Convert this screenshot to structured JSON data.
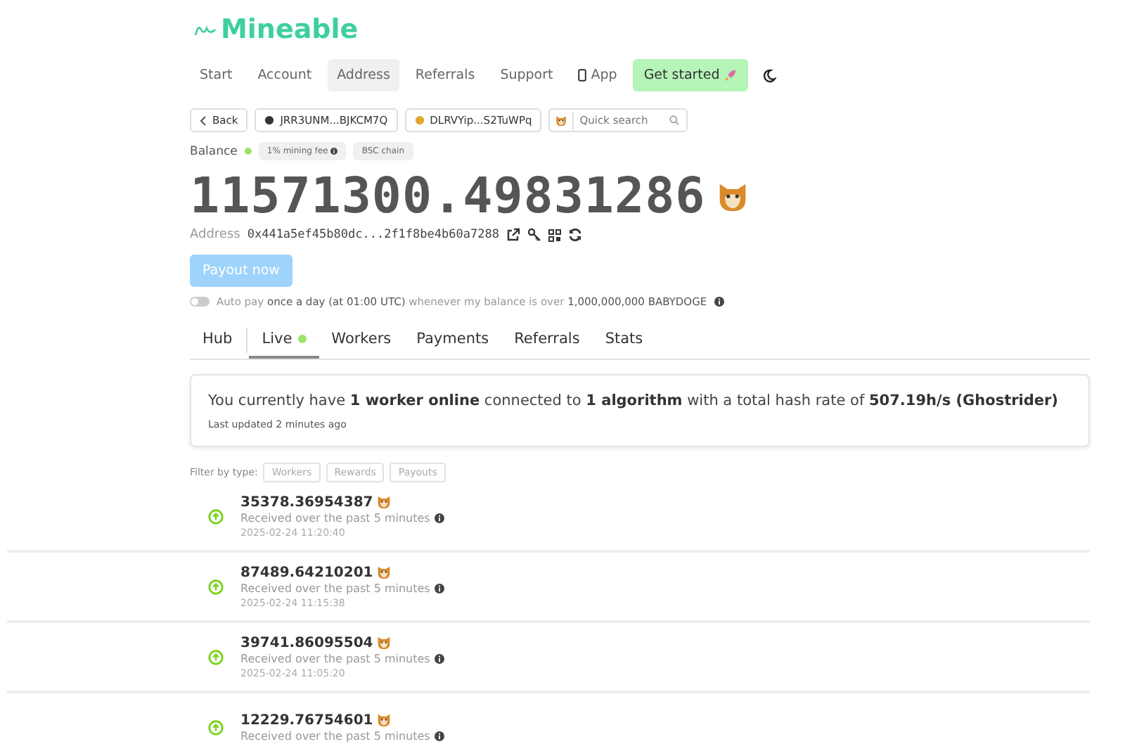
{
  "brand": "Mineable",
  "nav": [
    {
      "label": "Start",
      "selected": false,
      "kind": "link"
    },
    {
      "label": "Account",
      "selected": false,
      "kind": "link"
    },
    {
      "label": "Address",
      "selected": true,
      "kind": "link"
    },
    {
      "label": "Referrals",
      "selected": false,
      "kind": "link"
    },
    {
      "label": "Support",
      "selected": false,
      "kind": "link"
    },
    {
      "label": "App",
      "selected": false,
      "kind": "app"
    },
    {
      "label": "Get started",
      "selected": false,
      "kind": "cta"
    }
  ],
  "toolbar": {
    "back": "Back",
    "wallets": [
      "JRR3UNM...BJKCM7Q",
      "DLRVYip...S2TuWPq"
    ],
    "search": {
      "placeholder": "Quick search"
    }
  },
  "balance": {
    "label": "Balance",
    "tags": [
      "1% mining fee",
      "BSC chain"
    ],
    "amount": "11571300.49831286",
    "address_label": "Address",
    "address": "0x441a5ef45b80dc...2f1f8be4b60a7288",
    "payout_button": "Payout now",
    "autopay": {
      "on": false,
      "text": "Auto pay **once a day (at 01:00 UTC)** whenever my balance is over **1,000,000,000 BABYDOGE**"
    }
  },
  "tabs": [
    {
      "label": "Hub",
      "selected": false,
      "live_dot": false
    },
    {
      "label": "Live",
      "selected": true,
      "live_dot": true
    },
    {
      "label": "Workers",
      "selected": false,
      "live_dot": false
    },
    {
      "label": "Payments",
      "selected": false,
      "live_dot": false
    },
    {
      "label": "Referrals",
      "selected": false,
      "live_dot": false
    },
    {
      "label": "Stats",
      "selected": false,
      "live_dot": false
    }
  ],
  "summary": {
    "text": "You currently have **1 worker online** connected to **1 algorithm** with a total hash rate of **507.19h/s (Ghostrider)**",
    "updated": "Last updated 2 minutes ago"
  },
  "filter": {
    "label": "Filter by type:",
    "options": [
      "Workers",
      "Rewards",
      "Payouts"
    ]
  },
  "events": [
    {
      "amount": "35378.36954387",
      "description": "Received over the past 5 minutes",
      "time": "2025-02-24 11:20:40"
    },
    {
      "amount": "87489.64210201",
      "description": "Received over the past 5 minutes",
      "time": "2025-02-24 11:15:38"
    },
    {
      "amount": "39741.86095504",
      "description": "Received over the past 5 minutes",
      "time": "2025-02-24 11:05:20"
    },
    {
      "amount": "12229.76754601",
      "description": "Received over the past 5 minutes"
    }
  ]
}
